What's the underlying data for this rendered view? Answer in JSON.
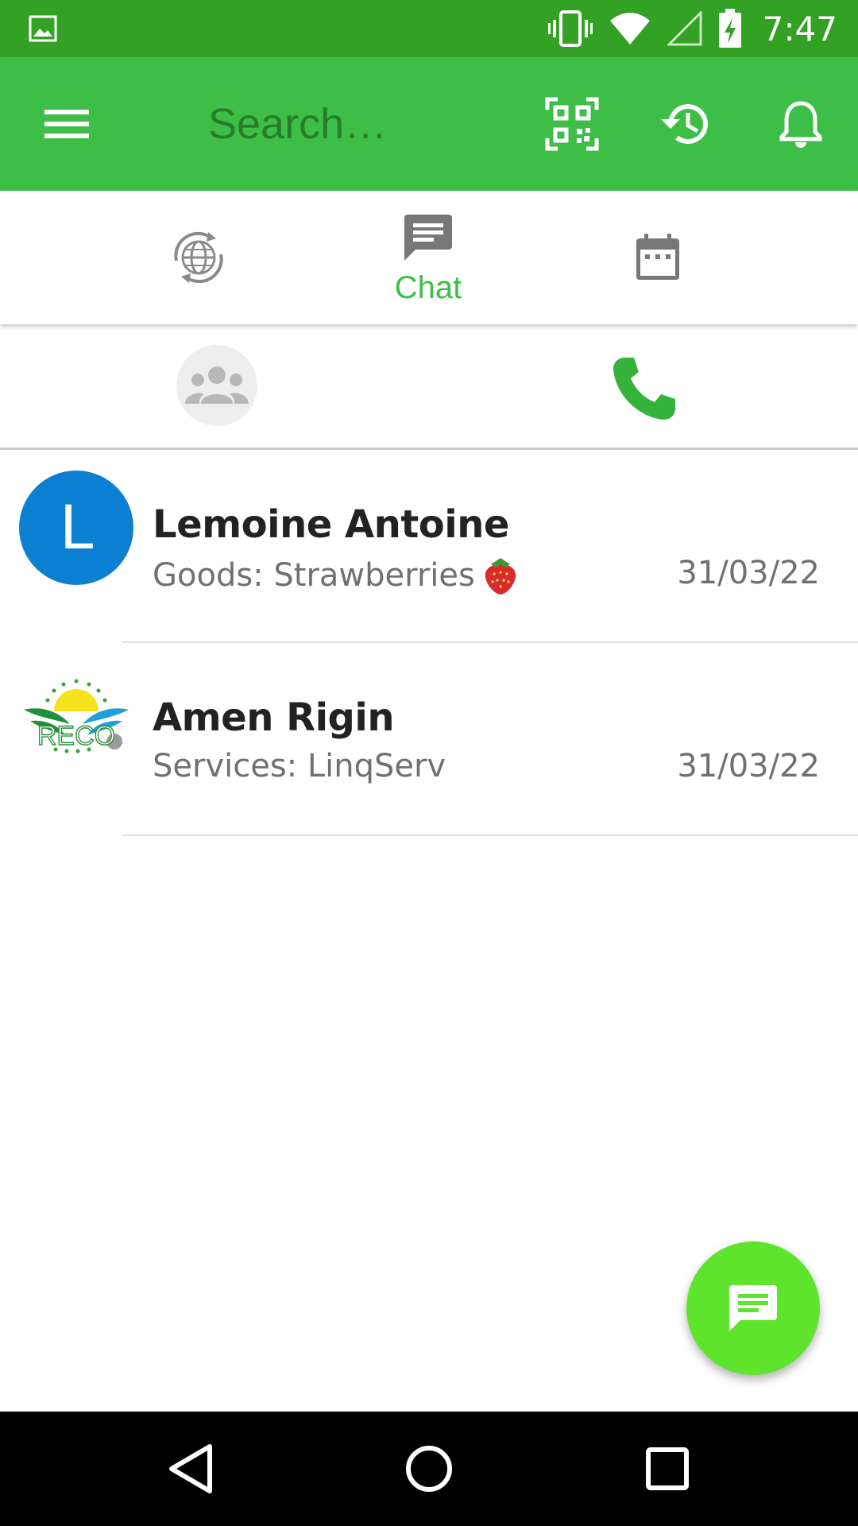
{
  "status_bar": {
    "time": "7:47",
    "icons": [
      "gallery-icon",
      "vibrate-icon",
      "wifi-icon",
      "signal-icon",
      "battery-charging-icon"
    ]
  },
  "toolbar": {
    "search_placeholder": "Search…",
    "icons": [
      "menu-icon",
      "qr-code-icon",
      "history-icon",
      "bell-icon"
    ]
  },
  "tabs": [
    {
      "name": "globe-sync",
      "label": "",
      "icon": "globe-sync-icon",
      "active": false
    },
    {
      "name": "chat",
      "label": "Chat",
      "icon": "chat-icon",
      "active": true
    },
    {
      "name": "calendar",
      "label": "",
      "icon": "calendar-icon",
      "active": false
    }
  ],
  "subtabs": [
    {
      "name": "groups",
      "icon": "group-icon"
    },
    {
      "name": "calls",
      "icon": "phone-icon"
    }
  ],
  "chats": [
    {
      "name": "Lemoine Antoine",
      "avatar_letter": "L",
      "preview": "Goods: Strawberries",
      "preview_emoji": "strawberry-icon",
      "date": "31/03/22"
    },
    {
      "name": "Amen Rigin",
      "avatar_logo_text": "RECO",
      "preview": "Services: LinqServ",
      "date": "31/03/22"
    }
  ],
  "colors": {
    "status_bar": "#33a124",
    "toolbar": "#3dbf47",
    "accent": "#3dbf47",
    "fab": "#5ee42c",
    "avatar_blue": "#0b7fd1"
  },
  "fab": {
    "icon": "new-message-icon"
  },
  "navbar": {
    "icons": [
      "back-icon",
      "home-icon",
      "recents-icon"
    ]
  }
}
